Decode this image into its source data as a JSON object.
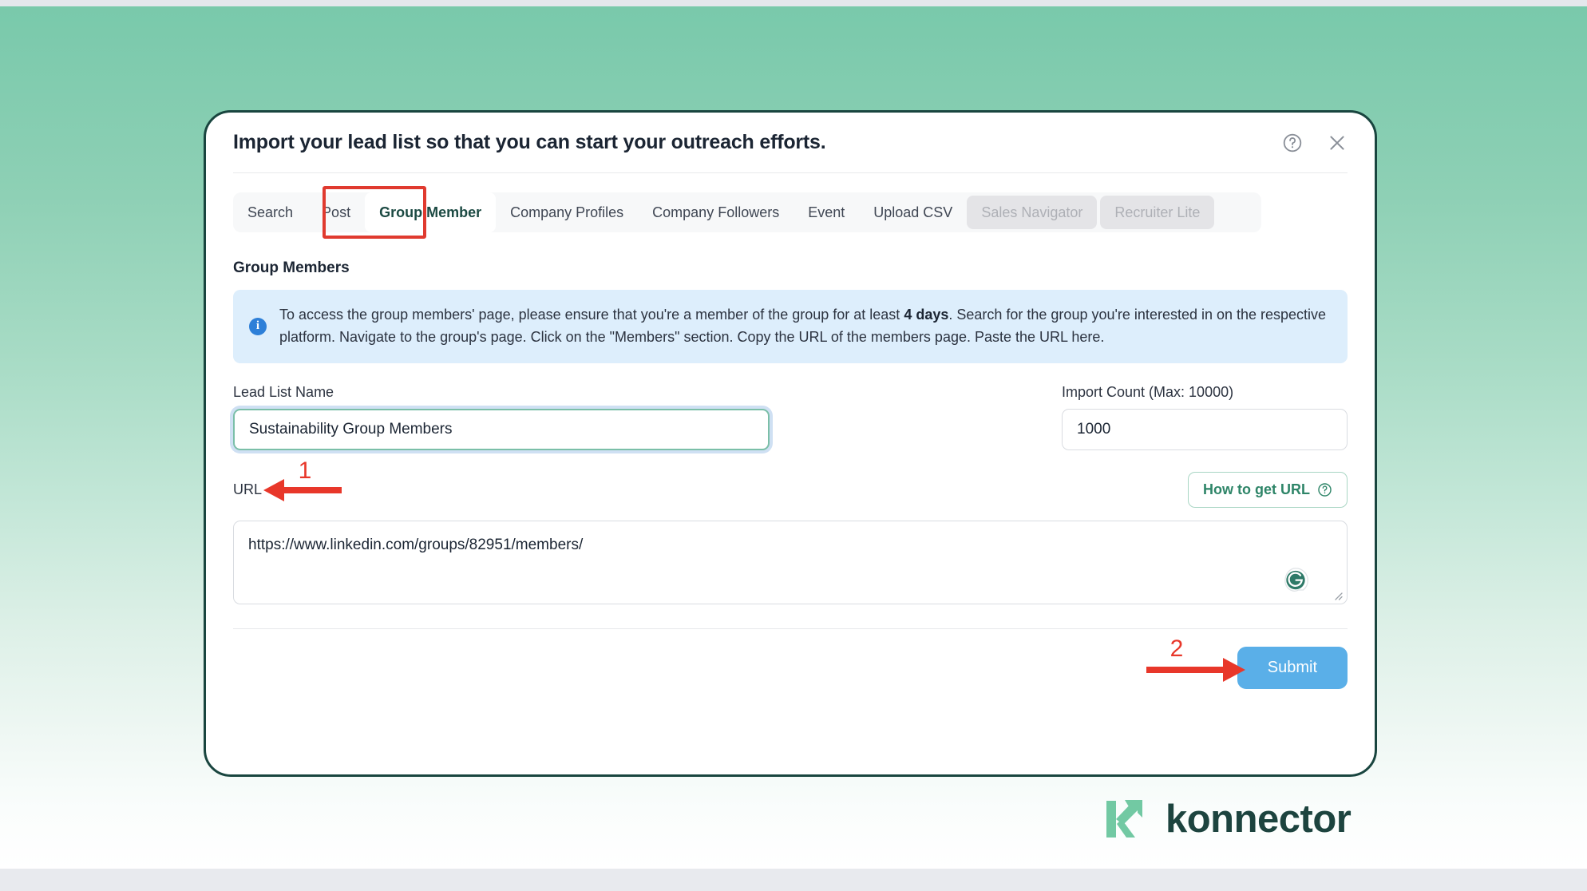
{
  "theme": {
    "bg_gradient_top": "#79c9ab",
    "bg_gradient_bottom": "#ffffff",
    "modal_border": "#19453f",
    "accent_green": "#2e8568",
    "submit_blue": "#5aafe8",
    "annotation_red": "#e03a2f",
    "info_blue_bg": "#ddeefc",
    "info_icon_blue": "#2d7fd8",
    "brand_dark": "#1d443f",
    "brand_light": "#72c9a3"
  },
  "modal": {
    "title": "Import your lead list so that you can start your outreach efforts.",
    "help_icon": "help-circle-icon",
    "close_icon": "close-icon"
  },
  "tabs": [
    {
      "label": "Search",
      "state": "default"
    },
    {
      "label": "Post",
      "state": "default"
    },
    {
      "label": "Group Member",
      "state": "active"
    },
    {
      "label": "Company Profiles",
      "state": "default"
    },
    {
      "label": "Company Followers",
      "state": "default"
    },
    {
      "label": "Event",
      "state": "default"
    },
    {
      "label": "Upload CSV",
      "state": "default"
    },
    {
      "label": "Sales Navigator",
      "state": "disabled"
    },
    {
      "label": "Recruiter Lite",
      "state": "disabled"
    }
  ],
  "section": {
    "title": "Group Members"
  },
  "info": {
    "icon": "info-icon",
    "text_part1": "To access the group members' page, please ensure that you're a member of the group for at least ",
    "highlight": "4 days",
    "text_part2": ". Search for the group you're interested in on the respective platform. Navigate to the group's page. Click on the \"Members\" section. Copy the URL of the members page. Paste the URL here."
  },
  "fields": {
    "lead_list": {
      "label": "Lead List Name",
      "value": "Sustainability Group Members",
      "placeholder": "Lead List Name"
    },
    "import_count": {
      "label": "Import Count (Max: 10000)",
      "value": "1000",
      "placeholder": "Import Count"
    },
    "url": {
      "label": "URL",
      "value": "https://www.linkedin.com/groups/82951/members/",
      "placeholder": "Paste the URL here",
      "help_button": "How to get URL",
      "help_button_icon": "question-circle-icon",
      "grammarly_icon": "grammarly-icon",
      "resize_handle": "resize-handle-icon"
    }
  },
  "footer": {
    "submit_label": "Submit"
  },
  "annotations": [
    {
      "number": "1",
      "target": "URL label",
      "direction": "left"
    },
    {
      "number": "2",
      "target": "Submit button",
      "direction": "right"
    }
  ],
  "brand": {
    "name": "konnector",
    "logo_icon": "konnector-k-arrow-logo"
  }
}
